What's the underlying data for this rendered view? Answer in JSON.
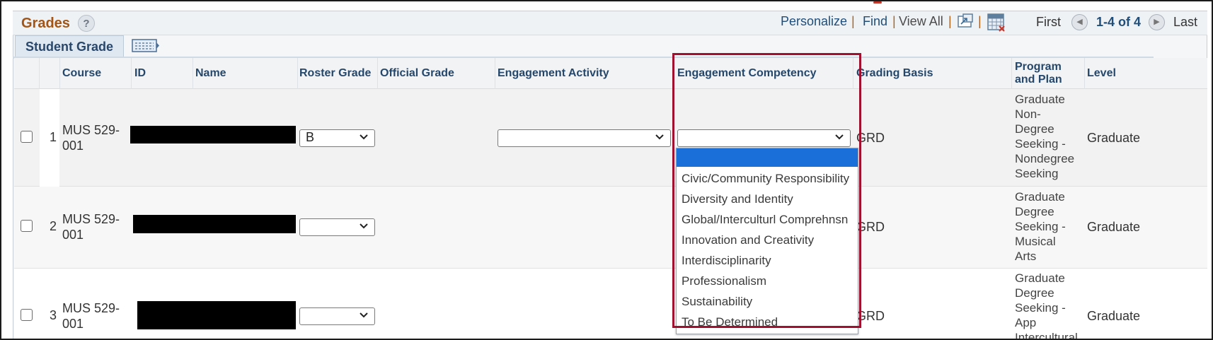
{
  "header": {
    "title": "Grades",
    "help_icon": "?",
    "toolbar": {
      "personalize": "Personalize",
      "find": "Find",
      "view_all": "View All",
      "separator": "|",
      "first": "First",
      "count": "1-4 of 4",
      "last": "Last"
    }
  },
  "tab": {
    "label": "Student Grade"
  },
  "columns": {
    "course": "Course",
    "id": "ID",
    "name": "Name",
    "roster_grade": "Roster Grade",
    "official_grade": "Official Grade",
    "engagement_activity": "Engagement Activity",
    "engagement_competency": "Engagement Competency",
    "grading_basis": "Grading Basis",
    "program_and_plan": "Program\nand Plan",
    "level": "Level"
  },
  "rows": [
    {
      "num": "1",
      "course": "MUS 529-\n001",
      "roster_grade": "B",
      "grading_basis": "GRD",
      "program": "Graduate\nNon-\nDegree\nSeeking -\nNondegree\nSeeking",
      "level": "Graduate"
    },
    {
      "num": "2",
      "course": "MUS 529-\n001",
      "roster_grade": "",
      "grading_basis": "GRD",
      "program": "Graduate\nDegree\nSeeking -\nMusical\nArts",
      "level": "Graduate"
    },
    {
      "num": "3",
      "course": "MUS 529-\n001",
      "roster_grade": "",
      "grading_basis": "GRD",
      "program": "Graduate\nDegree\nSeeking -\nApp\nIntercultural",
      "level": "Graduate"
    }
  ],
  "dropdown": {
    "selected": "",
    "options": [
      "Civic/Community Responsibility",
      "Diversity and Identity",
      "Global/Interculturl Comprehnsn",
      "Innovation and Creativity",
      "Interdisciplinarity",
      "Professionalism",
      "Sustainability",
      "To Be Determined"
    ]
  },
  "colors": {
    "title": "#a35516",
    "link": "#1f4e7a",
    "header_text": "#25476b",
    "dropdown_selected": "#1a6fd8",
    "highlight": "#a0102f"
  },
  "icons": {
    "help": "help-icon",
    "zoom": "zoom-icon",
    "download": "download-grid-icon",
    "first": "previous-arrow-icon",
    "last": "next-arrow-icon",
    "tab_view": "show-all-columns-icon"
  }
}
